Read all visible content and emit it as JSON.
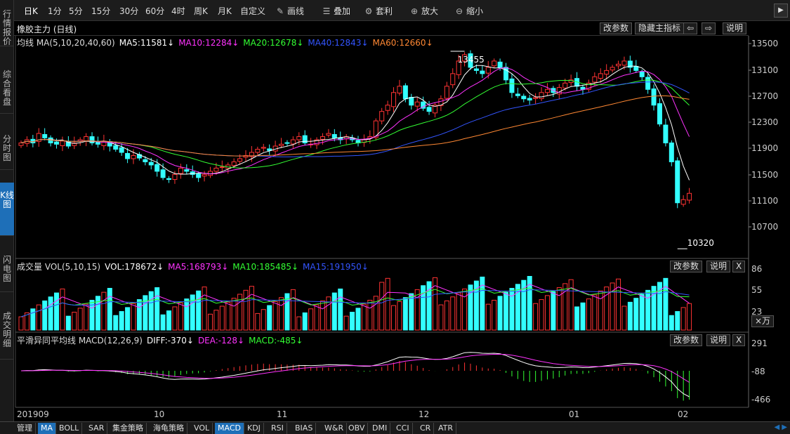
{
  "toolbar": {
    "periods": [
      "日K",
      "1分",
      "5分",
      "15分",
      "30分",
      "60分",
      "4时",
      "周K",
      "月K",
      "自定义"
    ],
    "active_period": "日K",
    "tools": [
      {
        "label": "画线",
        "icon": "pencil-icon"
      },
      {
        "label": "叠加",
        "icon": "stack-icon"
      },
      {
        "label": "套利",
        "icon": "arbitrage-icon"
      },
      {
        "label": "放大",
        "icon": "zoom-in-icon"
      },
      {
        "label": "缩小",
        "icon": "zoom-out-icon"
      }
    ]
  },
  "left_nav": [
    "行情报价",
    "综合看盘",
    "分时图",
    "K线图",
    "闪电图",
    "成交明细"
  ],
  "left_nav_active": "K线图",
  "title": "橡胶主力 (日线)",
  "title_buttons": {
    "change_params": "改参数",
    "hide_main": "隐藏主指标",
    "left": "⇦",
    "right": "⇨",
    "help": "说明"
  },
  "ma_legend": [
    {
      "text": "均线 MA(5,10,20,40,60)",
      "color": "#dddddd"
    },
    {
      "text": "MA5:11581↓",
      "color": "#ffffff"
    },
    {
      "text": "MA10:12284↓",
      "color": "#ff33ff"
    },
    {
      "text": "MA20:12678↓",
      "color": "#33ff33"
    },
    {
      "text": "MA40:12843↓",
      "color": "#3355ff"
    },
    {
      "text": "MA60:12660↓",
      "color": "#ff8833"
    }
  ],
  "vol_legend": [
    {
      "text": "成交量 VOL(5,10,15)",
      "color": "#dddddd"
    },
    {
      "text": "VOL:178672↓",
      "color": "#ffffff"
    },
    {
      "text": "MA5:168793↓",
      "color": "#ff33ff"
    },
    {
      "text": "MA10:185485↓",
      "color": "#33ff33"
    },
    {
      "text": "MA15:191950↓",
      "color": "#3355ff"
    }
  ],
  "macd_legend": [
    {
      "text": "平滑异同平均线 MACD(12,26,9)",
      "color": "#dddddd"
    },
    {
      "text": "DIFF:-370↓",
      "color": "#ffffff"
    },
    {
      "text": "DEA:-128↓",
      "color": "#ff33ff"
    },
    {
      "text": "MACD:-485↓",
      "color": "#33ff33"
    }
  ],
  "panel_buttons": {
    "change_params": "改参数",
    "help": "说明",
    "close": "X"
  },
  "vol_unit": "×万",
  "price_axis": [
    "13500",
    "13100",
    "12700",
    "12300",
    "11900",
    "11500",
    "11100",
    "10700"
  ],
  "vol_axis": [
    "86",
    "55",
    "23"
  ],
  "macd_axis": [
    "291",
    "-88",
    "-466"
  ],
  "x_axis": [
    "201909",
    "10",
    "11",
    "12",
    "01",
    "02"
  ],
  "annotations": {
    "high": "13455",
    "low": "10320"
  },
  "bottom_tabs": [
    "管理",
    "MA",
    "BOLL",
    "SAR",
    "集金策略",
    "海龟策略",
    "VOL",
    "MACD",
    "KDJ",
    "RSI",
    "BIAS",
    "W&R",
    "OBV",
    "DMI",
    "CCI",
    "CR",
    "ATR"
  ],
  "bottom_active": [
    "MA",
    "MACD"
  ],
  "colors": {
    "up": "#ff3333",
    "down": "#33ffff",
    "ma5": "#ffffff",
    "ma10": "#ff33ff",
    "ma20": "#33ff33",
    "ma40": "#3355ff",
    "ma60": "#ff8833"
  },
  "chart_data": {
    "type": "candlestick",
    "series_note": "rubber main contract daily",
    "price_range": [
      10320,
      13455
    ],
    "closes": [
      12000,
      12050,
      12000,
      12150,
      12080,
      12000,
      11980,
      12030,
      11950,
      12000,
      12050,
      12100,
      12000,
      11980,
      12030,
      11950,
      11900,
      11850,
      11750,
      11800,
      11760,
      11700,
      11650,
      11550,
      11450,
      11420,
      11500,
      11600,
      11550,
      11500,
      11450,
      11500,
      11550,
      11600,
      11620,
      11650,
      11700,
      11750,
      11800,
      11850,
      11900,
      11930,
      11880,
      11950,
      11980,
      12000,
      12050,
      12100,
      12000,
      11980,
      12050,
      12100,
      12150,
      12080,
      12050,
      12100,
      12050,
      12000,
      12050,
      12100,
      12350,
      12500,
      12600,
      12800,
      12900,
      12700,
      12600,
      12650,
      12550,
      12500,
      12600,
      12700,
      12900,
      13100,
      13300,
      13400,
      13200,
      13150,
      13100,
      13200,
      13300,
      13200,
      13000,
      12800,
      12750,
      12700,
      12680,
      12720,
      12800,
      12850,
      12800,
      12880,
      12950,
      13000,
      12900,
      12850,
      12950,
      13050,
      13100,
      13150,
      13200,
      13250,
      13300,
      13200,
      13150,
      13050,
      12850,
      12600,
      12300,
      12000,
      11700,
      11050,
      11100,
      11200
    ]
  }
}
